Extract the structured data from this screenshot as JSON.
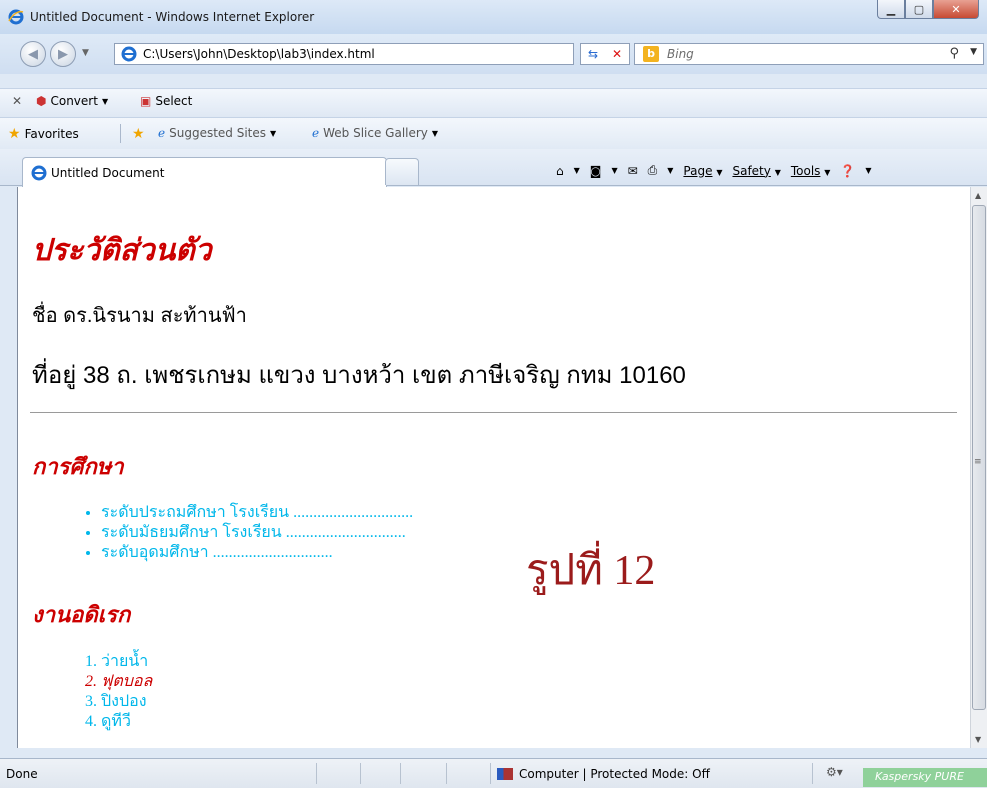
{
  "window": {
    "title": "Untitled Document - Windows Internet Explorer"
  },
  "address": {
    "url": "C:\\Users\\John\\Desktop\\lab3\\index.html",
    "search_placeholder": "Bing",
    "bing_letter": "b"
  },
  "commandbar": {
    "convert": "Convert",
    "select": "Select"
  },
  "favorites": {
    "favorites": "Favorites",
    "suggested": "Suggested Sites",
    "webslice": "Web Slice Gallery"
  },
  "tabs": [
    {
      "label": "Untitled Document"
    }
  ],
  "toolbar": {
    "page": "Page",
    "safety": "Safety",
    "tools": "Tools"
  },
  "page": {
    "heading": "ประวัติส่วนตัว",
    "name_line": "ชื่อ ดร.นิรนาม สะท้านฟ้า",
    "address_line": "ที่อยู่ 38 ถ. เพชรเกษม แขวง บางหว้า เขต ภาษีเจริญ กทม 10160",
    "education_title": "การศึกษา",
    "education": [
      "ระดับประถมศึกษา โรงเรียน ..............................",
      "ระดับมัธยมศึกษา โรงเรียน ..............................",
      "ระดับอุดมศึกษา .............................."
    ],
    "hobby_title": "งานอดิเรก",
    "hobbies": [
      "ว่ายน้ำ",
      "ฟุตบอล",
      "ปิงปอง",
      "ดูทีวี"
    ],
    "caption": "รูปที่ 12"
  },
  "status": {
    "done": "Done",
    "zone": "Computer | Protected Mode: Off",
    "kaspersky": "Kaspersky PURE"
  }
}
